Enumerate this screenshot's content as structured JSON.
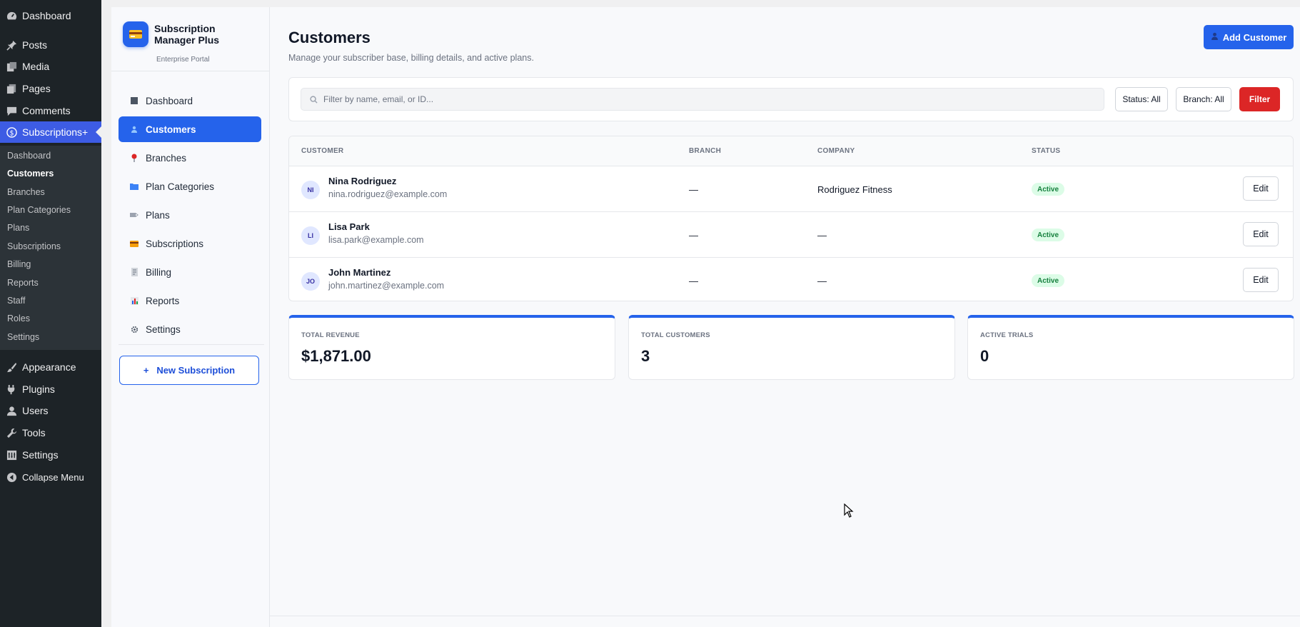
{
  "wp_menu": {
    "items_top": [
      {
        "label": "Dashboard",
        "icon": "gauge-icon"
      },
      {
        "label": "Posts",
        "icon": "pin-icon"
      },
      {
        "label": "Media",
        "icon": "media-icon"
      },
      {
        "label": "Pages",
        "icon": "pages-icon"
      },
      {
        "label": "Comments",
        "icon": "comment-icon"
      },
      {
        "label": "Subscriptions+",
        "icon": "dollar-icon"
      }
    ],
    "submenu": [
      "Dashboard",
      "Customers",
      "Branches",
      "Plan Categories",
      "Plans",
      "Subscriptions",
      "Billing",
      "Reports",
      "Staff",
      "Roles",
      "Settings"
    ],
    "items_bottom": [
      {
        "label": "Appearance",
        "icon": "brush-icon"
      },
      {
        "label": "Plugins",
        "icon": "plug-icon"
      },
      {
        "label": "Users",
        "icon": "user-icon"
      },
      {
        "label": "Tools",
        "icon": "wrench-icon"
      },
      {
        "label": "Settings",
        "icon": "settings-icon"
      },
      {
        "label": "Collapse Menu",
        "icon": "collapse-icon"
      }
    ]
  },
  "brand": {
    "title": "Subscription Manager Plus",
    "subtitle": "Enterprise Portal",
    "icon": "credit-card-icon"
  },
  "nav": {
    "items": [
      {
        "label": "Dashboard",
        "icon": "grid-icon"
      },
      {
        "label": "Customers",
        "icon": "person-icon"
      },
      {
        "label": "Branches",
        "icon": "location-pin-icon"
      },
      {
        "label": "Plan Categories",
        "icon": "folder-icon"
      },
      {
        "label": "Plans",
        "icon": "tag-icon"
      },
      {
        "label": "Subscriptions",
        "icon": "card-icon"
      },
      {
        "label": "Billing",
        "icon": "receipt-icon"
      },
      {
        "label": "Reports",
        "icon": "bar-chart-icon"
      },
      {
        "label": "Settings",
        "icon": "gear-icon"
      }
    ],
    "active": "Customers",
    "new_subscription": "+   New Subscription"
  },
  "page": {
    "title": "Customers",
    "subtitle": "Manage your subscriber base, billing details, and active plans.",
    "add_customer": "Add Customer"
  },
  "filters": {
    "search_placeholder": "Filter by name, email, or ID...",
    "status": "Status: All",
    "branch": "Branch: All",
    "filter": "Filter"
  },
  "table": {
    "headers": [
      "CUSTOMER",
      "BRANCH",
      "COMPANY",
      "STATUS"
    ],
    "rows": [
      {
        "initials": "NI",
        "name": "Nina Rodriguez",
        "email": "nina.rodriguez@example.com",
        "branch": "—",
        "company": "Rodriguez Fitness",
        "status": "Active",
        "action": "Edit"
      },
      {
        "initials": "LI",
        "name": "Lisa Park",
        "email": "lisa.park@example.com",
        "branch": "—",
        "company": "—",
        "status": "Active",
        "action": "Edit"
      },
      {
        "initials": "JO",
        "name": "John Martinez",
        "email": "john.martinez@example.com",
        "branch": "—",
        "company": "—",
        "status": "Active",
        "action": "Edit"
      }
    ]
  },
  "stats": [
    {
      "label": "TOTAL REVENUE",
      "value": "$1,871.00"
    },
    {
      "label": "TOTAL CUSTOMERS",
      "value": "3"
    },
    {
      "label": "ACTIVE TRIALS",
      "value": "0"
    }
  ],
  "colors": {
    "wp_menu_bg": "#1d2327",
    "accent": "#2563eb",
    "danger": "#dc2626",
    "status_active_bg": "#dcfce7",
    "status_active_text": "#15803d"
  }
}
